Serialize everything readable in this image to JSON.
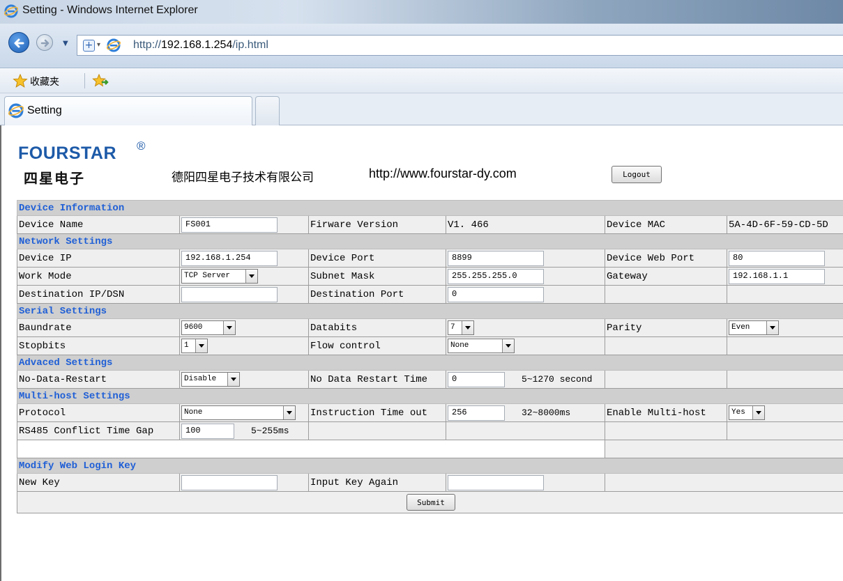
{
  "window": {
    "title": "Setting - Windows Internet Explorer"
  },
  "address_bar": {
    "url_prefix": "http://",
    "url_host": "192.168.1.254",
    "url_path": "/ip.html"
  },
  "favorites": {
    "label": "收藏夹"
  },
  "tabs": [
    {
      "label": "Setting"
    }
  ],
  "header": {
    "logo_en": "FOURSTAR",
    "logo_reg": "®",
    "logo_cn": "四星电子",
    "company": "德阳四星电子技术有限公司",
    "website": "http://www.fourstar-dy.com",
    "logout": "Logout"
  },
  "device_info": {
    "title": "Device Information",
    "name_label": "Device Name",
    "name_value": "FS001",
    "fw_label": "Firware Version",
    "fw_value": "V1. 466",
    "mac_label": "Device MAC",
    "mac_value": "5A-4D-6F-59-CD-5D"
  },
  "network": {
    "title": "Network Settings",
    "ip_label": "Device IP",
    "ip_value": "192.168.1.254",
    "port_label": "Device Port",
    "port_value": "8899",
    "webport_label": "Device Web Port",
    "webport_value": "80",
    "workmode_label": "Work Mode",
    "workmode_value": "TCP Server",
    "subnet_label": "Subnet Mask",
    "subnet_value": "255.255.255.0",
    "gateway_label": "Gateway",
    "gateway_value": "192.168.1.1",
    "destip_label": "Destination IP/DSN",
    "destip_value": "",
    "destport_label": "Destination Port",
    "destport_value": "0"
  },
  "serial": {
    "title": "Serial Settings",
    "baud_label": "Baundrate",
    "baud_value": "9600",
    "databits_label": "Databits",
    "databits_value": "7",
    "parity_label": "Parity",
    "parity_value": "Even",
    "stopbits_label": "Stopbits",
    "stopbits_value": "1",
    "flow_label": "Flow control",
    "flow_value": "None"
  },
  "advanced": {
    "title": "Advaced Settings",
    "ndr_label": "No-Data-Restart",
    "ndr_value": "Disable",
    "ndrtime_label": "No Data Restart Time",
    "ndrtime_value": "0",
    "ndrtime_range": "5~1270 second"
  },
  "multihost": {
    "title": "Multi-host Settings",
    "protocol_label": "Protocol",
    "protocol_value": "None",
    "timeout_label": "Instruction Time out",
    "timeout_value": "256",
    "timeout_range": "32~8000ms",
    "enable_label": "Enable Multi-host",
    "enable_value": "Yes",
    "rs485_label": "RS485 Conflict Time Gap",
    "rs485_value": "100",
    "rs485_range": "5~255ms"
  },
  "login_key": {
    "title": "Modify Web Login Key",
    "new_label": "New Key",
    "new_value": "",
    "again_label": "Input Key Again",
    "again_value": ""
  },
  "submit": {
    "label": "Submit"
  },
  "colors": {
    "section_text": "#1f5fd6",
    "section_bg": "#cfcfcf",
    "cell_bg": "#efefef",
    "brand": "#1d5aa8"
  }
}
